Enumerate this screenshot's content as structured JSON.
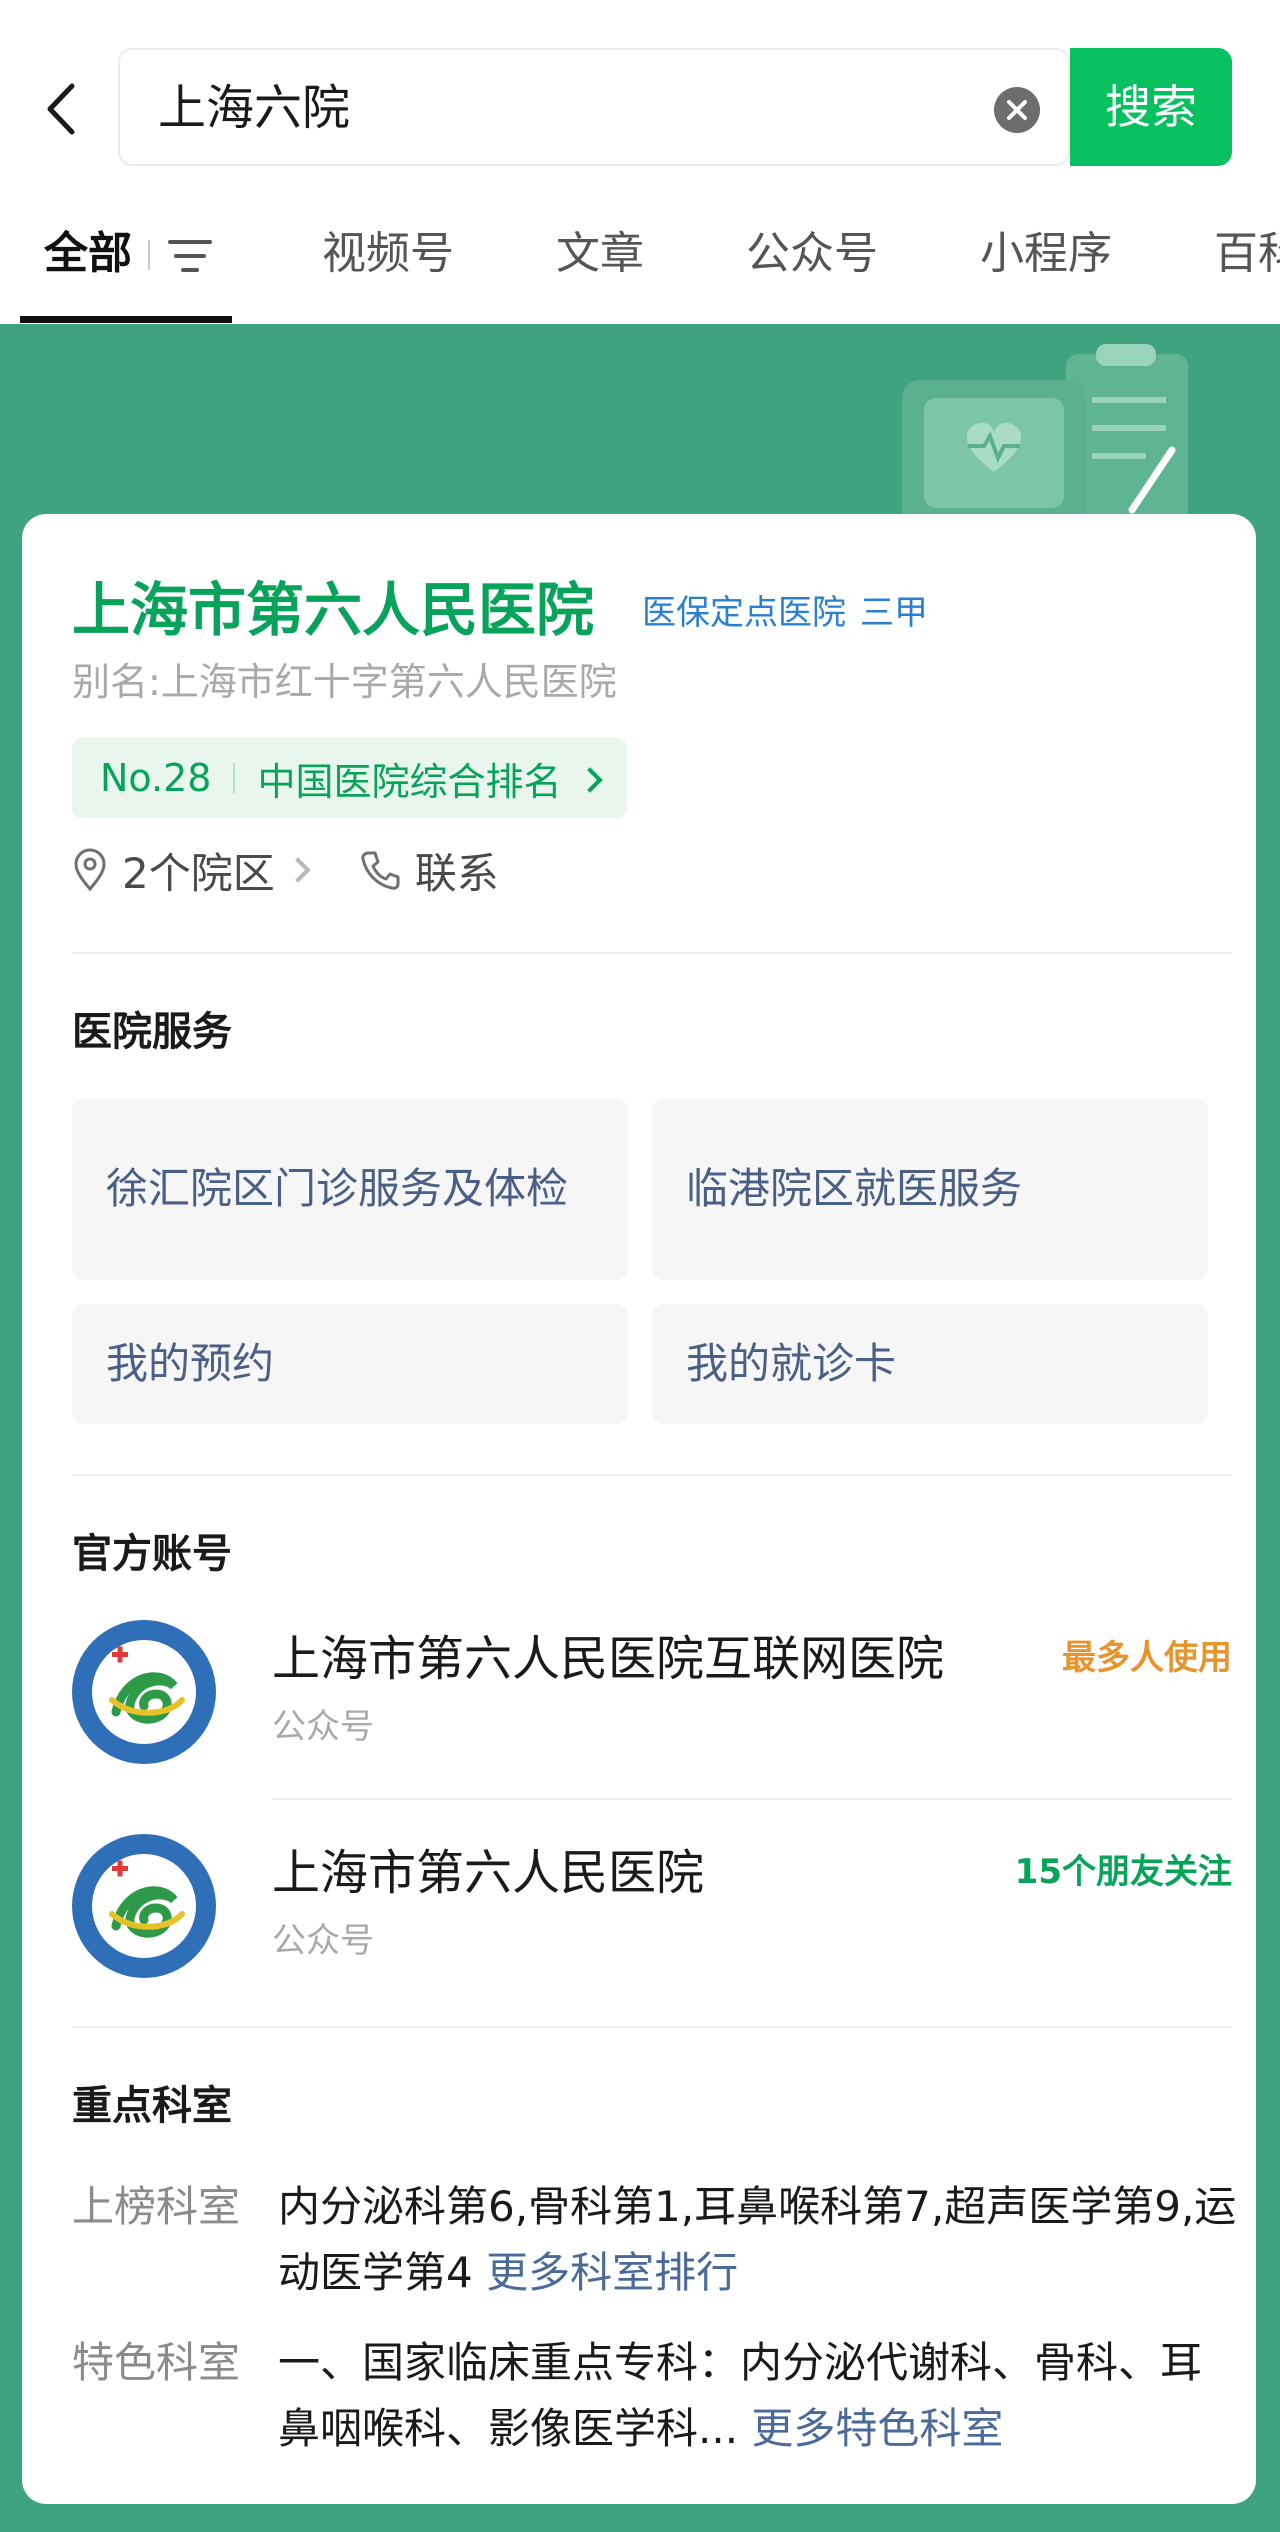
{
  "search": {
    "query": "上海六院",
    "button_label": "搜索"
  },
  "tabs": [
    {
      "label": "全部",
      "active": true
    },
    {
      "label": "视频号"
    },
    {
      "label": "文章"
    },
    {
      "label": "公众号"
    },
    {
      "label": "小程序"
    },
    {
      "label": "百科"
    }
  ],
  "hospital": {
    "name": "上海市第六人民医院",
    "tags": [
      "医保定点医院",
      "三甲"
    ],
    "alias": "别名:上海市红十字第六人民医院",
    "rank_no": "No.28",
    "rank_label": "中国医院综合排名",
    "campus": "2个院区",
    "contact": "联系"
  },
  "services": {
    "title": "医院服务",
    "items": [
      "徐汇院区门诊服务及体检",
      "临港院区就医服务",
      "我的预约",
      "我的就诊卡"
    ]
  },
  "official_accounts": {
    "title": "官方账号",
    "items": [
      {
        "name": "上海市第六人民医院互联网医院",
        "type": "公众号",
        "badge": "最多人使用"
      },
      {
        "name": "上海市第六人民医院",
        "type": "公众号",
        "badge": "15个朋友关注"
      }
    ]
  },
  "departments": {
    "title": "重点科室",
    "ranked": {
      "label": "上榜科室",
      "text": "内分泌科第6,骨科第1,耳鼻喉科第7,超声医学第9,运动医学第4",
      "link": "更多科室排行"
    },
    "featured": {
      "label": "特色科室",
      "text": "一、国家临床重点专科：内分泌代谢科、骨科、耳鼻咽喉科、影像医学科...",
      "link": "更多特色科室"
    }
  },
  "colors": {
    "brand_green": "#07c160",
    "band_green": "#3fa37f",
    "orange": "#e8942c"
  }
}
